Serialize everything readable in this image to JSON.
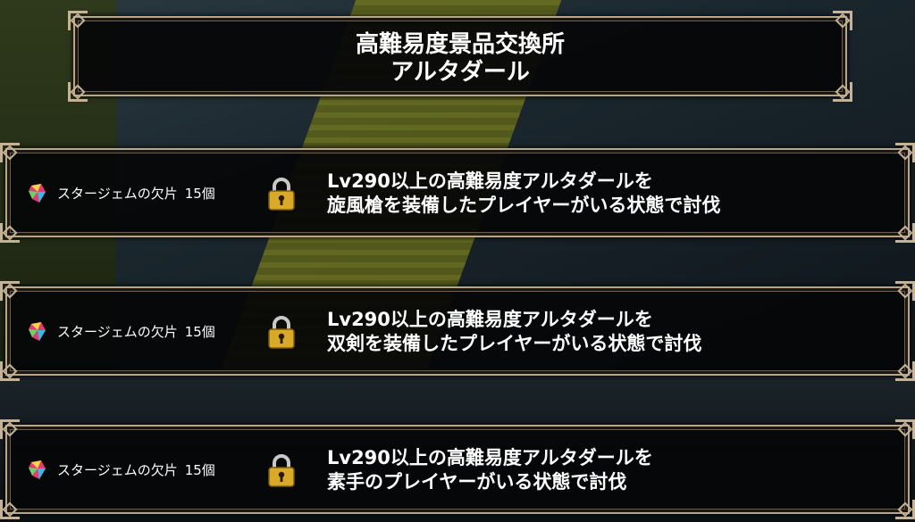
{
  "header": {
    "title_line1": "高難易度景品交換所",
    "title_line2": "アルタダール"
  },
  "rewards": [
    {
      "item": "スタージェムの欠片",
      "quantity": "15個",
      "condition_line1": "Lv290以上の高難易度アルタダールを",
      "condition_line2": "旋風槍を装備したプレイヤーがいる状態で討伐",
      "locked": true,
      "icon": "star-gem-fragment-icon"
    },
    {
      "item": "スタージェムの欠片",
      "quantity": "15個",
      "condition_line1": "Lv290以上の高難易度アルタダールを",
      "condition_line2": "双剣を装備したプレイヤーがいる状態で討伐",
      "locked": true,
      "icon": "star-gem-fragment-icon"
    },
    {
      "item": "スタージェムの欠片",
      "quantity": "15個",
      "condition_line1": "Lv290以上の高難易度アルタダールを",
      "condition_line2": "素手のプレイヤーがいる状態で討伐",
      "locked": true,
      "icon": "star-gem-fragment-icon"
    }
  ],
  "colors": {
    "panel_border": "#b9a688",
    "panel_fill": "#050608",
    "text": "#ffffff",
    "lock_gold": "#d9a92a"
  }
}
